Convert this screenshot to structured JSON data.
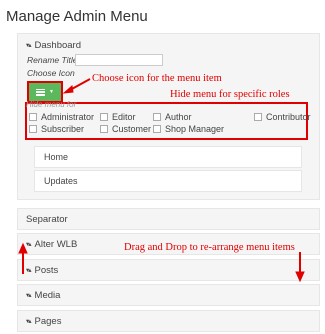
{
  "page": {
    "title": "Manage Admin Menu"
  },
  "dashboard": {
    "label": "Dashboard",
    "rename_title_label": "Rename Title",
    "rename_title_value": "",
    "choose_icon_label": "Choose Icon",
    "hide_menu_label": "Hide menu for",
    "roles": [
      "Administrator",
      "Editor",
      "Author",
      "Contributor",
      "Subscriber",
      "Customer",
      "Shop Manager"
    ],
    "submenu": [
      "Home",
      "Updates"
    ]
  },
  "menu_rows": {
    "separator": "Separator",
    "alter_wlb": "Alter WLB",
    "posts": "Posts",
    "media": "Media",
    "pages": "Pages"
  },
  "annotations": {
    "choose_icon": "Choose icon for the menu item",
    "hide_menu": "Hide menu for specific roles",
    "drag_drop": "Drag and Drop to re-arrange menu items"
  },
  "colors": {
    "icon_button": "#5cb85c",
    "annotation": "#e00000"
  }
}
